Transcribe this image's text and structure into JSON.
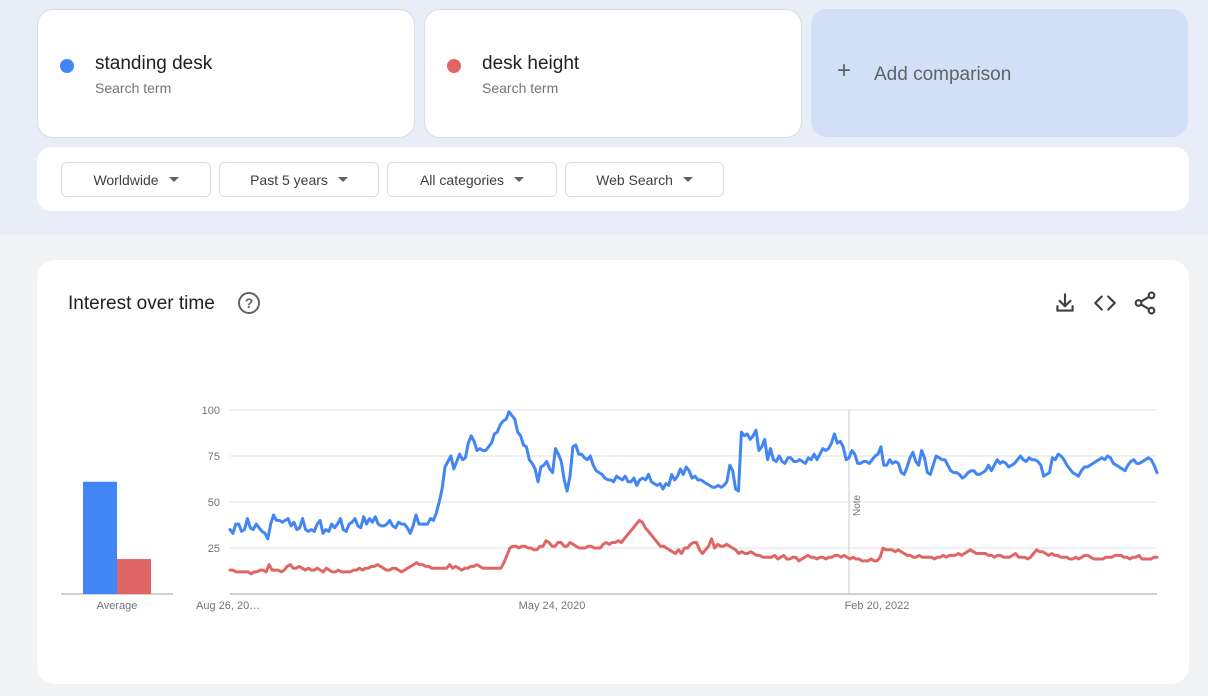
{
  "terms": [
    {
      "name": "standing desk",
      "subtitle": "Search term",
      "color": "#4285f4"
    },
    {
      "name": "desk height",
      "subtitle": "Search term",
      "color": "#e06666"
    }
  ],
  "add_comparison": {
    "icon": "plus-icon",
    "label": "Add comparison"
  },
  "filters": [
    {
      "label": "Worldwide"
    },
    {
      "label": "Past 5 years"
    },
    {
      "label": "All categories"
    },
    {
      "label": "Web Search"
    }
  ],
  "chart_panel": {
    "title": "Interest over time",
    "help_icon": "question-circle-icon",
    "tools": [
      "download-icon",
      "embed-code-icon",
      "share-icon"
    ]
  },
  "chart_data": {
    "type": "line",
    "y_ticks": [
      25,
      50,
      75,
      100
    ],
    "ylim": [
      0,
      100
    ],
    "x_tick_labels": [
      "Aug 26, 20…",
      "May 24, 2020",
      "Feb 20, 2022"
    ],
    "note_label": "Note",
    "grid": true,
    "average": {
      "label": "Average",
      "values": [
        {
          "series": "standing desk",
          "value": 61
        },
        {
          "series": "desk height",
          "value": 19
        }
      ]
    },
    "series": [
      {
        "name": "standing desk",
        "color": "#4285f4",
        "values": [
          35,
          33,
          38,
          38,
          34,
          35,
          41,
          36,
          35,
          38,
          36,
          34,
          33,
          30,
          38,
          43,
          40,
          40,
          39,
          40,
          41,
          37,
          39,
          35,
          36,
          41,
          35,
          34,
          35,
          34,
          38,
          40,
          33,
          35,
          34,
          38,
          36,
          38,
          41,
          35,
          34,
          38,
          39,
          41,
          37,
          36,
          42,
          38,
          41,
          39,
          42,
          38,
          37,
          37,
          38,
          40,
          37,
          36,
          39,
          38,
          38,
          36,
          33,
          37,
          43,
          38,
          38,
          38,
          38,
          41,
          40,
          44,
          50,
          57,
          69,
          72,
          75,
          68,
          72,
          76,
          73,
          74,
          82,
          86,
          83,
          78,
          79,
          78,
          78,
          80,
          82,
          87,
          88,
          92,
          94,
          95,
          99,
          97,
          95,
          88,
          86,
          81,
          80,
          73,
          71,
          68,
          61,
          69,
          70,
          72,
          68,
          66,
          79,
          76,
          72,
          62,
          56,
          64,
          80,
          81,
          76,
          76,
          74,
          73,
          75,
          70,
          67,
          66,
          65,
          63,
          62,
          62,
          61,
          64,
          63,
          62,
          64,
          61,
          61,
          63,
          59,
          62,
          63,
          62,
          65,
          61,
          60,
          59,
          60,
          57,
          60,
          59,
          65,
          62,
          64,
          68,
          65,
          69,
          67,
          63,
          64,
          62,
          62,
          61,
          60,
          59,
          58,
          58,
          59,
          58,
          59,
          61,
          70,
          67,
          57,
          56,
          88,
          86,
          87,
          84,
          86,
          89,
          78,
          80,
          84,
          73,
          79,
          73,
          72,
          75,
          72,
          71,
          74,
          74,
          72,
          72,
          73,
          72,
          71,
          74,
          73,
          76,
          73,
          76,
          79,
          78,
          79,
          82,
          87,
          82,
          83,
          80,
          73,
          74,
          78,
          76,
          71,
          71,
          72,
          72,
          71,
          73,
          75,
          76,
          80,
          70,
          70,
          73,
          71,
          72,
          71,
          66,
          65,
          69,
          74,
          77,
          72,
          70,
          78,
          74,
          66,
          65,
          70,
          75,
          74,
          73,
          73,
          70,
          67,
          66,
          66,
          65,
          63,
          64,
          66,
          67,
          67,
          65,
          65,
          66,
          67,
          70,
          67,
          70,
          73,
          71,
          72,
          71,
          69,
          70,
          71,
          73,
          75,
          73,
          72,
          74,
          73,
          73,
          72,
          70,
          64,
          65,
          66,
          74,
          73,
          76,
          75,
          73,
          70,
          68,
          66,
          65,
          64,
          67,
          69,
          69,
          70,
          71,
          72,
          73,
          74,
          73,
          75,
          74,
          71,
          70,
          69,
          68,
          67,
          70,
          72,
          73,
          71,
          71,
          72,
          73,
          74,
          73,
          70,
          66
        ]
      },
      {
        "name": "desk height",
        "color": "#e06666",
        "values": [
          13,
          13,
          12,
          12,
          12,
          12,
          12,
          11,
          12,
          12,
          13,
          13,
          12,
          16,
          13,
          13,
          13,
          12,
          13,
          15,
          16,
          14,
          14,
          15,
          14,
          13,
          14,
          13,
          13,
          14,
          13,
          12,
          14,
          13,
          12,
          12,
          13,
          12,
          12,
          12,
          12,
          13,
          13,
          14,
          13,
          14,
          14,
          15,
          15,
          16,
          15,
          14,
          13,
          13,
          14,
          14,
          13,
          12,
          13,
          14,
          15,
          16,
          17,
          16,
          16,
          15,
          15,
          14,
          14,
          14,
          14,
          14,
          14,
          16,
          14,
          15,
          14,
          13,
          14,
          14,
          15,
          15,
          16,
          15,
          14,
          14,
          14,
          14,
          14,
          14,
          14,
          17,
          21,
          25,
          26,
          26,
          25,
          26,
          26,
          25,
          25,
          24,
          24,
          26,
          26,
          29,
          28,
          26,
          26,
          28,
          28,
          26,
          26,
          28,
          27,
          26,
          25,
          25,
          25,
          26,
          26,
          25,
          25,
          25,
          27,
          28,
          27,
          28,
          28,
          29,
          28,
          30,
          32,
          34,
          36,
          38,
          40,
          39,
          36,
          34,
          32,
          30,
          28,
          26,
          26,
          25,
          24,
          23,
          22,
          24,
          22,
          25,
          25,
          27,
          28,
          28,
          24,
          22,
          24,
          26,
          30,
          25,
          27,
          26,
          26,
          27,
          26,
          25,
          24,
          22,
          23,
          22,
          22,
          23,
          22,
          21,
          21,
          20,
          20,
          20,
          20,
          21,
          19,
          20,
          21,
          19,
          19,
          20,
          20,
          18,
          19,
          20,
          21,
          20,
          20,
          19,
          20,
          20,
          19,
          20,
          20,
          21,
          21,
          20,
          21,
          20,
          19,
          20,
          19,
          19,
          18,
          18,
          18,
          19,
          18,
          18,
          20,
          25,
          24,
          24,
          24,
          23,
          24,
          23,
          22,
          21,
          21,
          20,
          20,
          21,
          20,
          20,
          20,
          20,
          19,
          20,
          20,
          21,
          20,
          21,
          21,
          21,
          22,
          21,
          22,
          23,
          24,
          23,
          22,
          22,
          22,
          22,
          21,
          21,
          20,
          21,
          21,
          20,
          20,
          20,
          21,
          22,
          20,
          20,
          20,
          19,
          20,
          22,
          24,
          23,
          23,
          22,
          21,
          22,
          21,
          21,
          20,
          20,
          20,
          19,
          19,
          20,
          19,
          20,
          21,
          21,
          20,
          19,
          19,
          19,
          19,
          20,
          20,
          20,
          21,
          21,
          21,
          20,
          20,
          19,
          20,
          20,
          21,
          19,
          19,
          19,
          19,
          20,
          20
        ]
      }
    ]
  }
}
